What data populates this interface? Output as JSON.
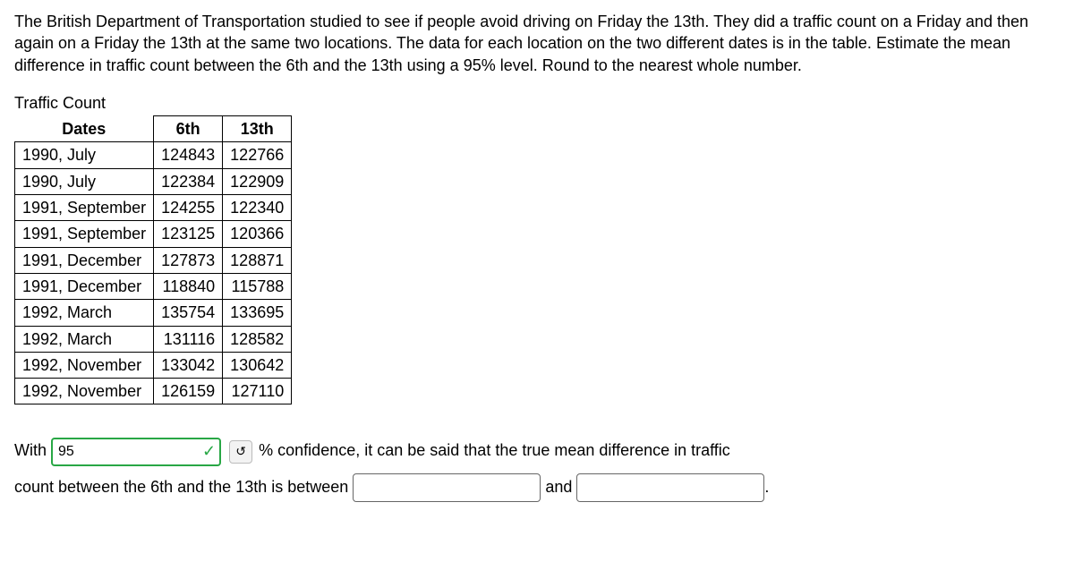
{
  "problem": "The British Department of Transportation studied to see if people avoid driving on Friday the 13th. They did a traffic count on a Friday and then again on a Friday the 13th at the same two locations. The data for each location on the two different dates is in the table. Estimate the mean difference in traffic count between the 6th and the 13th using a 95% level. Round to the nearest whole number.",
  "table": {
    "title": "Traffic Count",
    "headers": {
      "dates": "Dates",
      "c1": "6th",
      "c2": "13th"
    },
    "rows": [
      {
        "date": "1990, July",
        "c1": "124843",
        "c2": "122766"
      },
      {
        "date": "1990, July",
        "c1": "122384",
        "c2": "122909"
      },
      {
        "date": "1991, September",
        "c1": "124255",
        "c2": "122340"
      },
      {
        "date": "1991, September",
        "c1": "123125",
        "c2": "120366"
      },
      {
        "date": "1991, December",
        "c1": "127873",
        "c2": "128871"
      },
      {
        "date": "1991, December",
        "c1": "118840",
        "c2": "115788"
      },
      {
        "date": "1992, March",
        "c1": "135754",
        "c2": "133695"
      },
      {
        "date": "1992, March",
        "c1": "131116",
        "c2": "128582"
      },
      {
        "date": "1992, November",
        "c1": "133042",
        "c2": "130642"
      },
      {
        "date": "1992, November",
        "c1": "126159",
        "c2": "127110"
      }
    ]
  },
  "answer": {
    "with": "With",
    "confidence_value": "95",
    "pct_confidence": "% confidence, it can be said that the true mean difference in traffic",
    "line2a": "count between the 6th and the 13th is between",
    "and": "and",
    "period": ".",
    "lower": "",
    "upper": ""
  }
}
